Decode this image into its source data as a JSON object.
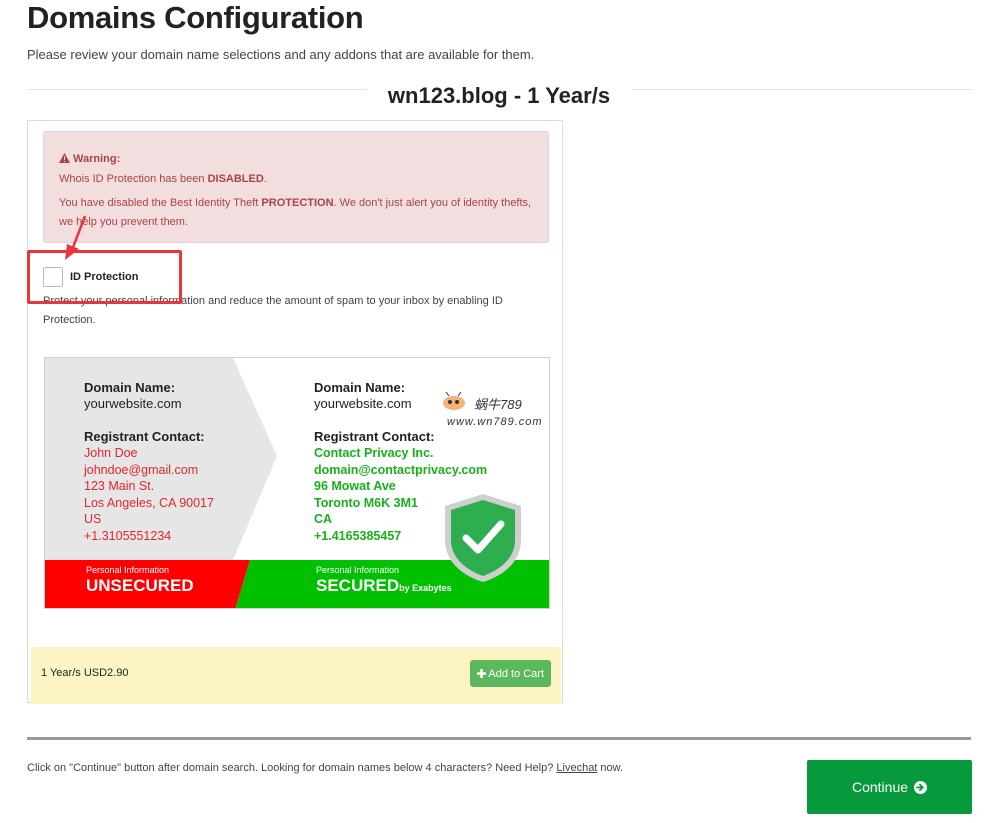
{
  "page": {
    "title": "Domains Configuration",
    "subtitle": "Please review your domain name selections and any addons that are available for them."
  },
  "domain_section": {
    "heading": "wn123.blog - 1 Year/s"
  },
  "warning": {
    "title": "Warning:",
    "line1_prefix": "Whois ID Protection has been ",
    "line1_emph": "DISABLED",
    "line1_suffix": ".",
    "line2_prefix": "You have disabled the Best Identity Theft ",
    "line2_emph": "PROTECTION",
    "line2_suffix": ". We don't just alert you of identity thefts, we help you prevent them."
  },
  "id_protection": {
    "label": "ID Protection",
    "checked": false,
    "description": "Protect your personal information and reduce the amount of spam to your inbox by enabling ID Protection."
  },
  "comparison_image": {
    "left": {
      "domain_label": "Domain Name:",
      "domain_value": "yourwebsite.com",
      "contact_label": "Registrant Contact:",
      "contact_lines": [
        "John Doe",
        "johndoe@gmail.com",
        "123 Main St.",
        "Los Angeles, CA 90017",
        "US",
        "+1.3105551234"
      ],
      "strip_small": "Personal Information",
      "strip_big": "UNSECURED"
    },
    "right": {
      "domain_label": "Domain Name:",
      "domain_value": "yourwebsite.com",
      "contact_label": "Registrant Contact:",
      "contact_lines": [
        "Contact Privacy Inc.",
        "domain@contactprivacy.com",
        "96 Mowat Ave",
        "Toronto M6K 3M1",
        "CA",
        "+1.4165385457"
      ],
      "strip_small": "Personal Information",
      "strip_big": "SECURED",
      "strip_by": "by Exabytes"
    },
    "watermark": {
      "cn": "蜗牛789",
      "url": "www.wn789.com"
    },
    "colors": {
      "red": "#e3262b",
      "green": "#19b01a",
      "strip_red": "#ff0000",
      "strip_green": "#00c000",
      "shield": "#2eae4f"
    }
  },
  "pricing": {
    "price": "1 Year/s USD2.90",
    "add_to_cart_label": "Add to Cart"
  },
  "footer": {
    "text_before": "Click on \"Continue\" button after domain search. Looking for domain names below 4 characters? Need Help? ",
    "link_label": "Livechat",
    "text_after": " now.",
    "continue_label": "Continue"
  },
  "colors": {
    "accent_green": "#079a3c",
    "cart_green": "#5cb85c",
    "warning_bg": "#f2dede",
    "warning_text": "#a94442",
    "highlight_red": "#e8373b",
    "price_bg": "#fcf5c3"
  }
}
